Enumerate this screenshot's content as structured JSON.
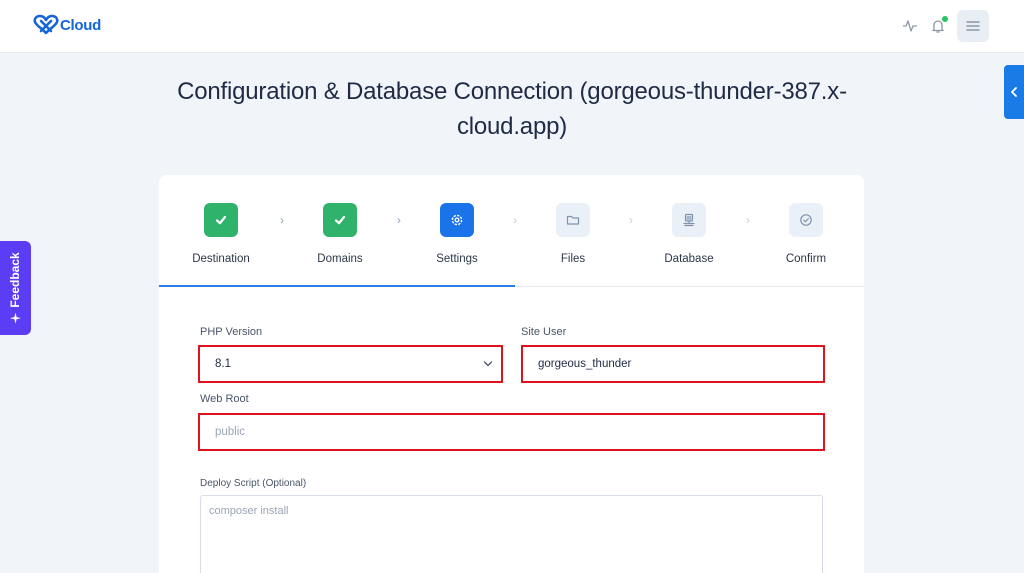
{
  "brand": {
    "name": "Cloud"
  },
  "colors": {
    "accent": "#1a73e8",
    "success": "#2fb36b",
    "highlight": "#e0141e",
    "feedback": "#5b3df5"
  },
  "header": {
    "icons": [
      "pulse-icon",
      "bell-icon",
      "menu-icon"
    ]
  },
  "feedback": {
    "label": "Feedback"
  },
  "page": {
    "title": "Configuration & Database Connection (gorgeous-thunder-387.x-cloud.app)"
  },
  "steps": [
    {
      "label": "Destination",
      "state": "done",
      "icon": "check-icon"
    },
    {
      "label": "Domains",
      "state": "done",
      "icon": "check-icon"
    },
    {
      "label": "Settings",
      "state": "active",
      "icon": "gear-icon"
    },
    {
      "label": "Files",
      "state": "pending",
      "icon": "folder-icon"
    },
    {
      "label": "Database",
      "state": "pending",
      "icon": "database-icon"
    },
    {
      "label": "Confirm",
      "state": "pending",
      "icon": "check-circle-icon"
    }
  ],
  "form": {
    "php_version": {
      "label": "PHP Version",
      "value": "8.1"
    },
    "site_user": {
      "label": "Site User",
      "value": "gorgeous_thunder"
    },
    "web_root": {
      "label": "Web Root",
      "placeholder": "public"
    },
    "deploy_script": {
      "label": "Deploy Script (Optional)",
      "placeholder": "composer install"
    }
  }
}
